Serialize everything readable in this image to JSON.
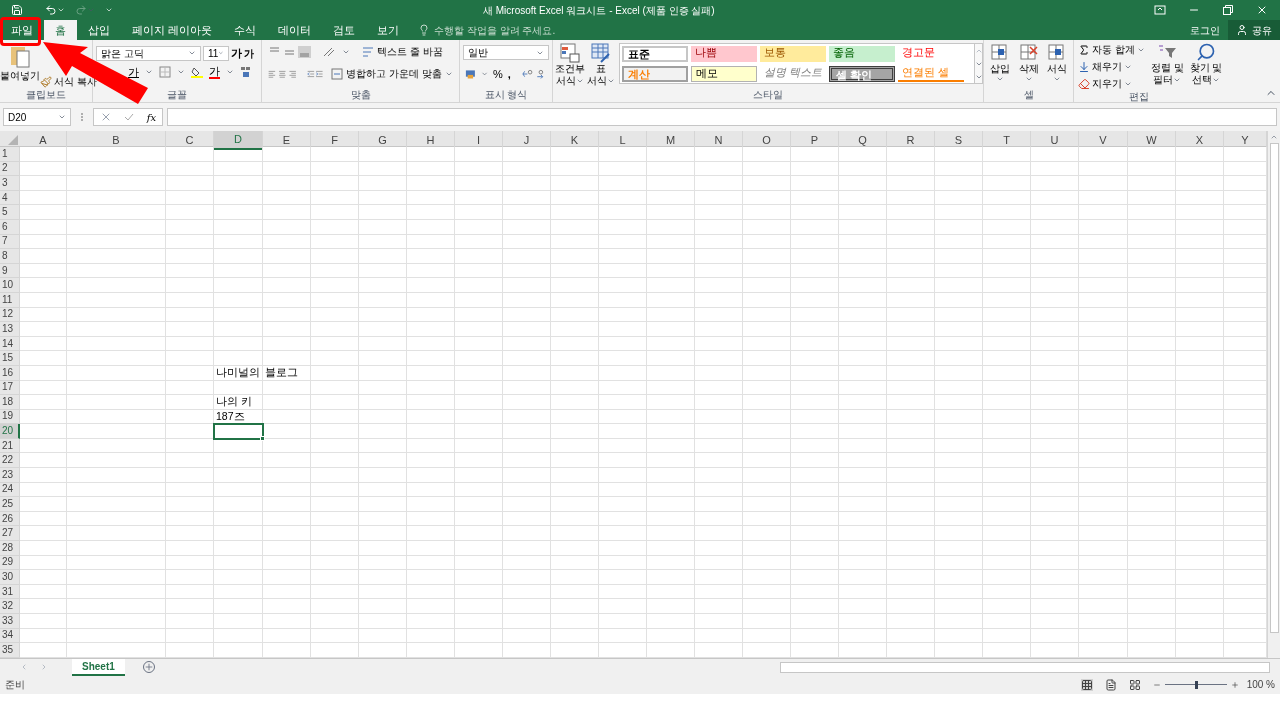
{
  "window": {
    "title": "새 Microsoft Excel 워크시트 - Excel (제품 인증 실패)",
    "login": "로그인",
    "share": "공유"
  },
  "tabs": [
    {
      "label": "파일",
      "selected": false
    },
    {
      "label": "홈",
      "selected": true
    },
    {
      "label": "삽입",
      "selected": false
    },
    {
      "label": "페이지 레이아웃",
      "selected": false
    },
    {
      "label": "수식",
      "selected": false
    },
    {
      "label": "데이터",
      "selected": false
    },
    {
      "label": "검토",
      "selected": false
    },
    {
      "label": "보기",
      "selected": false
    }
  ],
  "tell_me": {
    "placeholder": "수행할 작업을 알려 주세요."
  },
  "clipboard": {
    "paste": "붙여넣기",
    "format_painter": "서식 복사",
    "label": "클립보드"
  },
  "font": {
    "name": "맑은 고딕",
    "size": "11",
    "grow": "가",
    "shrink": "가",
    "underline": "가",
    "font_color": "가",
    "label": "글꼴"
  },
  "alignment": {
    "wrap_text": "텍스트 줄 바꿈",
    "merge": "병합하고 가운데 맞춤",
    "label": "맞춤"
  },
  "number": {
    "format": "일반",
    "percent": "%",
    "comma": ",",
    "label": "표시 형식"
  },
  "styles": {
    "conditional": [
      "조건부",
      "서식"
    ],
    "table": [
      "표",
      "서식"
    ],
    "label": "스타일",
    "cell_styles": [
      {
        "label": "표준",
        "kind": "normal"
      },
      {
        "label": "나쁨",
        "kind": "bad"
      },
      {
        "label": "보통",
        "kind": "neutral"
      },
      {
        "label": "좋음",
        "kind": "good"
      },
      {
        "label": "경고문",
        "kind": "warning"
      },
      {
        "label": "계산",
        "kind": "calculation"
      },
      {
        "label": "메모",
        "kind": "note"
      },
      {
        "label": "설명 텍스트",
        "kind": "explanatory"
      },
      {
        "label": "셀 확인",
        "kind": "check"
      },
      {
        "label": "연결된 셀",
        "kind": "linked"
      }
    ]
  },
  "cells_group": {
    "buttons": [
      "삽입",
      "삭제",
      "서식"
    ],
    "label": "셀"
  },
  "editing": {
    "autosum": "자동 합계",
    "fill": "채우기",
    "clear": "지우기",
    "sort": [
      "정렬 및",
      "필터"
    ],
    "find": [
      "찾기 및",
      "선택"
    ],
    "label": "편집"
  },
  "formula_bar": {
    "name_box": "D20",
    "fx": "fx"
  },
  "columns": [
    {
      "label": "A",
      "selected": false
    },
    {
      "label": "B",
      "selected": false
    },
    {
      "label": "C",
      "selected": false
    },
    {
      "label": "D",
      "selected": true
    },
    {
      "label": "E",
      "selected": false
    },
    {
      "label": "F",
      "selected": false
    },
    {
      "label": "G",
      "selected": false
    },
    {
      "label": "H",
      "selected": false
    },
    {
      "label": "I",
      "selected": false
    },
    {
      "label": "J",
      "selected": false
    },
    {
      "label": "K",
      "selected": false
    },
    {
      "label": "L",
      "selected": false
    },
    {
      "label": "M",
      "selected": false
    },
    {
      "label": "N",
      "selected": false
    },
    {
      "label": "O",
      "selected": false
    },
    {
      "label": "P",
      "selected": false
    },
    {
      "label": "Q",
      "selected": false
    },
    {
      "label": "R",
      "selected": false
    },
    {
      "label": "S",
      "selected": false
    },
    {
      "label": "T",
      "selected": false
    },
    {
      "label": "U",
      "selected": false
    },
    {
      "label": "V",
      "selected": false
    },
    {
      "label": "W",
      "selected": false
    },
    {
      "label": "X",
      "selected": false
    },
    {
      "label": "Y",
      "selected": false
    }
  ],
  "rows": [
    {
      "number": "1",
      "selected": false
    },
    {
      "number": "2",
      "selected": false
    },
    {
      "number": "3",
      "selected": false
    },
    {
      "number": "4",
      "selected": false
    },
    {
      "number": "5",
      "selected": false
    },
    {
      "number": "6",
      "selected": false
    },
    {
      "number": "7",
      "selected": false
    },
    {
      "number": "8",
      "selected": false
    },
    {
      "number": "9",
      "selected": false
    },
    {
      "number": "10",
      "selected": false
    },
    {
      "number": "11",
      "selected": false
    },
    {
      "number": "12",
      "selected": false
    },
    {
      "number": "13",
      "selected": false
    },
    {
      "number": "14",
      "selected": false
    },
    {
      "number": "15",
      "selected": false
    },
    {
      "number": "16",
      "selected": false,
      "column_d": "나미널의",
      "column_e": "블로그"
    },
    {
      "number": "17",
      "selected": false
    },
    {
      "number": "18",
      "selected": false,
      "column_d": "나의 키"
    },
    {
      "number": "19",
      "selected": false,
      "column_d": "187즈"
    },
    {
      "number": "20",
      "selected": true
    },
    {
      "number": "21",
      "selected": false
    },
    {
      "number": "22",
      "selected": false
    },
    {
      "number": "23",
      "selected": false
    },
    {
      "number": "24",
      "selected": false
    },
    {
      "number": "25",
      "selected": false
    },
    {
      "number": "26",
      "selected": false
    },
    {
      "number": "27",
      "selected": false
    },
    {
      "number": "28",
      "selected": false
    },
    {
      "number": "29",
      "selected": false
    },
    {
      "number": "30",
      "selected": false
    },
    {
      "number": "31",
      "selected": false
    },
    {
      "number": "32",
      "selected": false
    },
    {
      "number": "33",
      "selected": false
    },
    {
      "number": "34",
      "selected": false
    },
    {
      "number": "35",
      "selected": false
    }
  ],
  "sheets": [
    {
      "label": "Sheet1",
      "selected": true
    }
  ],
  "status_bar": {
    "status": "준비",
    "zoom": "100 %",
    "zoom_level": {
      "level": 0.5
    }
  }
}
